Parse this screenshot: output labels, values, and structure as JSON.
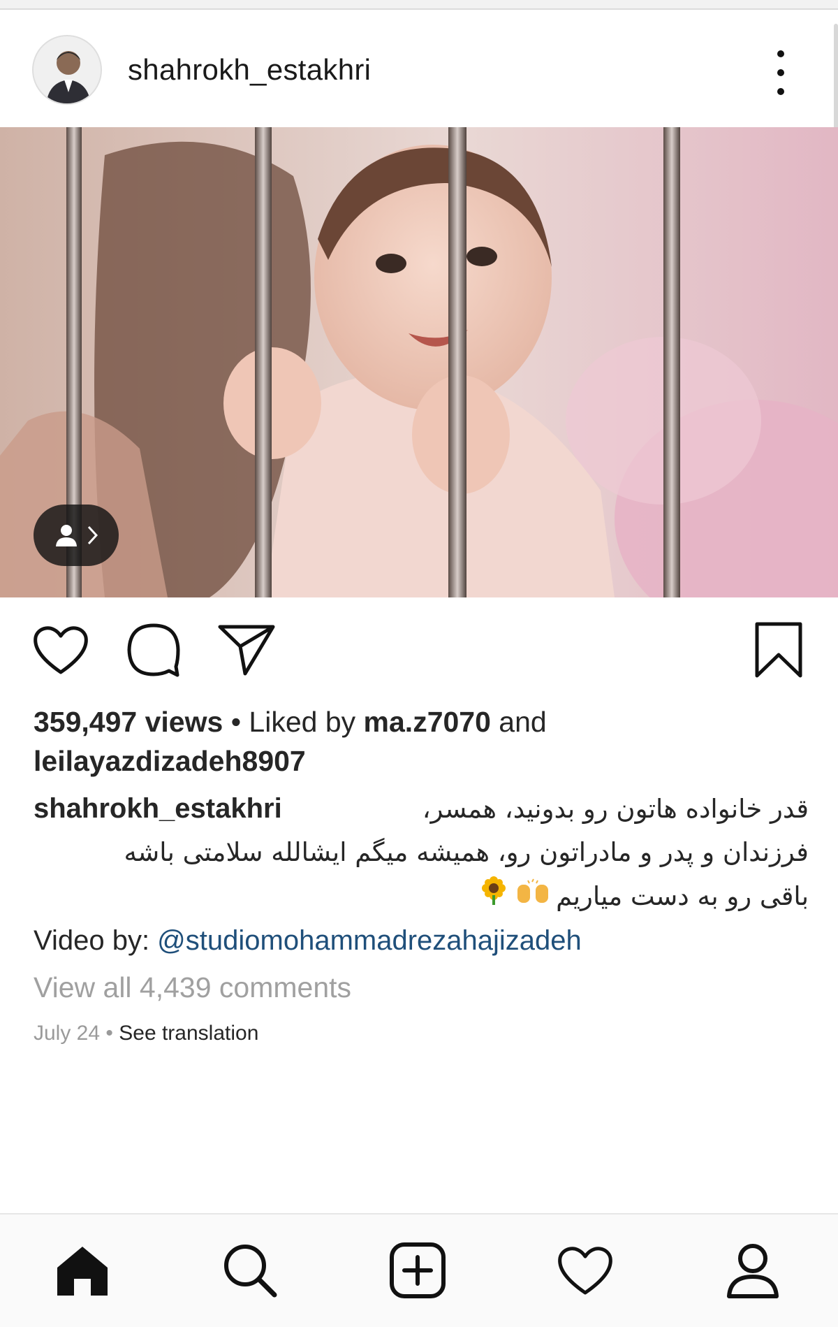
{
  "post": {
    "username": "shahrokh_estakhri",
    "views": "359,497 views",
    "liked_by_prefix": " • Liked by ",
    "liked_by_user1": "ma.z7070",
    "liked_and": " and",
    "liked_by_user2": "leilayazdizadeh8907",
    "caption_user": "shahrokh_estakhri",
    "caption_line1": "قدر خانواده هاتون رو بدونید، همسر،",
    "caption_line2": "فرزندان و پدر و مادراتون رو، همیشه میگم ایشالله سلامتی باشه",
    "caption_line3": "باقی رو به دست میاریم",
    "video_by_label": "Video by: ",
    "video_by_mention": "@studiomohammadrezahajizadeh",
    "view_comments": "View all 4,439 comments",
    "date": "July 24",
    "date_sep": " • ",
    "see_translation": "See translation"
  },
  "icons": {
    "more": "more-vertical-icon",
    "like": "heart-icon",
    "comment": "comment-bubble-icon",
    "share": "paper-plane-icon",
    "save": "bookmark-icon",
    "tag": "person-tag-icon",
    "home": "home-icon",
    "search": "search-icon",
    "add": "plus-square-icon",
    "activity": "heart-icon",
    "profile": "person-icon"
  },
  "colors": {
    "text": "#262626",
    "muted": "#9a9a9a",
    "mention": "#1f4f7a"
  }
}
